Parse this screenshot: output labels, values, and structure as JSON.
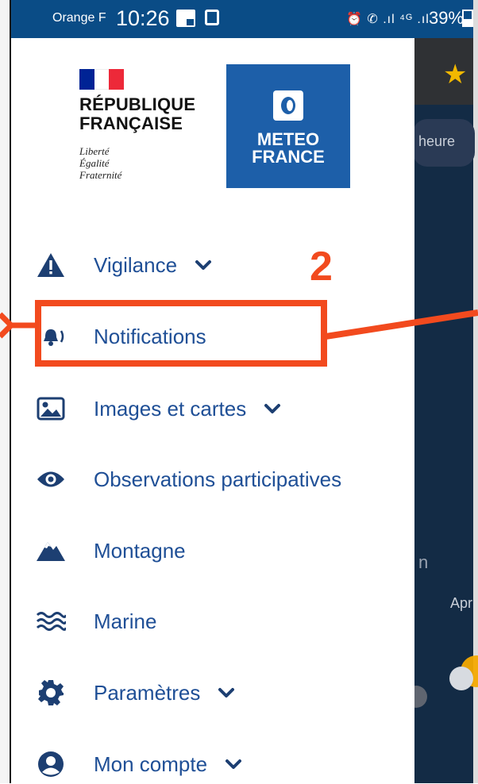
{
  "status_bar": {
    "carrier": "Orange F",
    "time": "10:26",
    "signal_text": "⏰ ✆ .ıl ⁴ᴳ .ıl",
    "battery": "39%"
  },
  "header": {
    "republique": {
      "title_line1": "RÉPUBLIQUE",
      "title_line2": "FRANÇAISE",
      "motto_line1": "Liberté",
      "motto_line2": "Égalité",
      "motto_line3": "Fraternité"
    },
    "meteo_france": {
      "line1": "METEO",
      "line2": "FRANCE"
    }
  },
  "menu": {
    "items": [
      {
        "label": "Vigilance",
        "icon": "warning-triangle-icon",
        "has_chevron": true
      },
      {
        "label": "Notifications",
        "icon": "notification-bell-icon",
        "has_chevron": false
      },
      {
        "label": "Images et cartes",
        "icon": "image-icon",
        "has_chevron": true
      },
      {
        "label": "Observations participatives",
        "icon": "eye-icon",
        "has_chevron": false
      },
      {
        "label": "Montagne",
        "icon": "mountain-icon",
        "has_chevron": false
      },
      {
        "label": "Marine",
        "icon": "waves-icon",
        "has_chevron": false
      },
      {
        "label": "Paramètres",
        "icon": "gear-icon",
        "has_chevron": true
      },
      {
        "label": "Mon compte",
        "icon": "user-icon",
        "has_chevron": true
      }
    ]
  },
  "annotation": {
    "step": "2",
    "color": "#f24a1e"
  },
  "background": {
    "pill_text": "heure",
    "fragment_1": "n",
    "fragment_2": "Apr"
  },
  "colors": {
    "brand_blue": "#1d5fa9",
    "menu_text": "#1f4f96",
    "status_bar": "#0a4c86"
  }
}
